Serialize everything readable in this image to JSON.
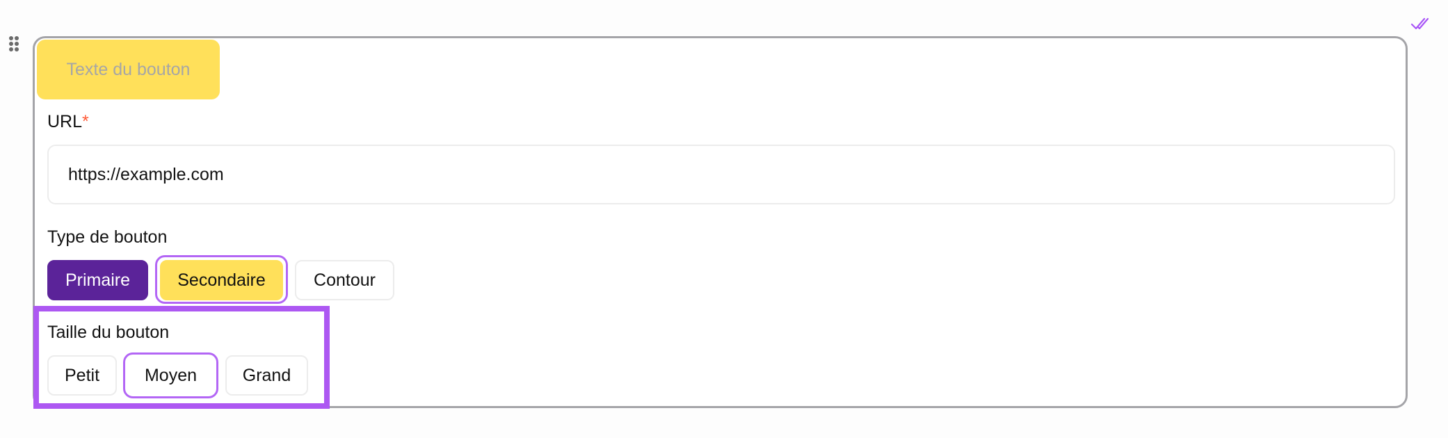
{
  "preview": {
    "button_text": "Texte du bouton"
  },
  "url_field": {
    "label": "URL",
    "required_mark": "*",
    "value": "https://example.com"
  },
  "button_type": {
    "label": "Type de bouton",
    "options": [
      "Primaire",
      "Secondaire",
      "Contour"
    ],
    "selected": "Secondaire"
  },
  "button_size": {
    "label": "Taille du bouton",
    "options": [
      "Petit",
      "Moyen",
      "Grand"
    ],
    "selected": "Moyen"
  },
  "icons": {
    "drag": "drag-handle-icon",
    "status": "double-check-icon"
  },
  "colors": {
    "accent_purple": "#5b2399",
    "selection_ring": "#b366f5",
    "highlight": "#ad58f2",
    "yellow": "#ffe05a",
    "required": "#ff5a36"
  }
}
